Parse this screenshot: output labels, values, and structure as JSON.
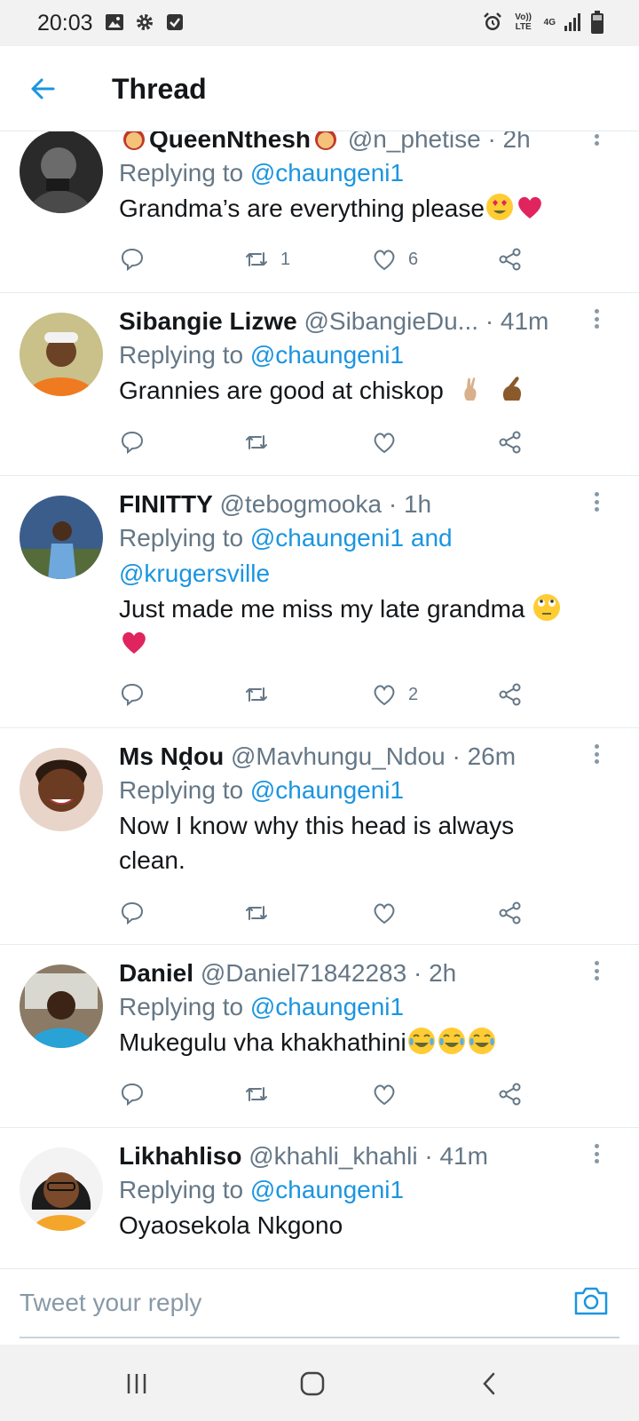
{
  "status_bar": {
    "time": "20:03",
    "network_top": "Vo)) LTE",
    "network_type": "4G",
    "left_icons": [
      "image-icon",
      "gear-icon",
      "checkbox-icon"
    ],
    "right_icons": [
      "alarm-icon",
      "volte-icon",
      "signal-icon",
      "battery-icon"
    ]
  },
  "header": {
    "title": "Thread",
    "back_icon": "arrow-left-icon"
  },
  "colors": {
    "accent": "#1b95e0",
    "secondary_text": "#657786",
    "divider": "#e6ecf0"
  },
  "tweets": [
    {
      "name": "QueenNthesh",
      "handle": "@n_phetise",
      "time": "· 2h",
      "replying_label": "Replying to",
      "replying_to": "@chaungeni1",
      "text": "Grandma’s are everything please",
      "replies": "",
      "retweets": "1",
      "likes": "6"
    },
    {
      "name": "Sibangie Lizwe",
      "handle": "@SibangieDu...",
      "time": "· 41m",
      "replying_label": "Replying to",
      "replying_to": "@chaungeni1",
      "text": "Grannies are good at chiskop",
      "replies": "",
      "retweets": "",
      "likes": ""
    },
    {
      "name": "FINITTY",
      "handle": "@tebogmooka",
      "time": "· 1h",
      "replying_label": "Replying to",
      "replying_to": "@chaungeni1 and",
      "replying_to_2": "@krugersville",
      "text": "Just made me miss my late grandma",
      "replies": "",
      "retweets": "",
      "likes": "2"
    },
    {
      "name": "Ms Nḓou",
      "handle": "@Mavhungu_Ndou",
      "time": "· 26m",
      "replying_label": "Replying to",
      "replying_to": "@chaungeni1",
      "text": "Now I know why this head is always clean.",
      "replies": "",
      "retweets": "",
      "likes": ""
    },
    {
      "name": "Daniel",
      "handle": "@Daniel71842283",
      "time": "· 2h",
      "replying_label": "Replying to",
      "replying_to": "@chaungeni1",
      "text": "Mukegulu vha khakhathini",
      "replies": "",
      "retweets": "",
      "likes": ""
    },
    {
      "name": "Likhahliso",
      "handle": "@khahli_khahli",
      "time": "· 41m",
      "replying_label": "Replying to",
      "replying_to": "@chaungeni1",
      "text": "Oyaosekola Nkgono"
    }
  ],
  "compose": {
    "placeholder": "Tweet your reply",
    "camera_icon": "camera-icon"
  },
  "nav_bar": {
    "buttons": [
      "recent-apps-icon",
      "home-icon",
      "back-icon"
    ]
  }
}
